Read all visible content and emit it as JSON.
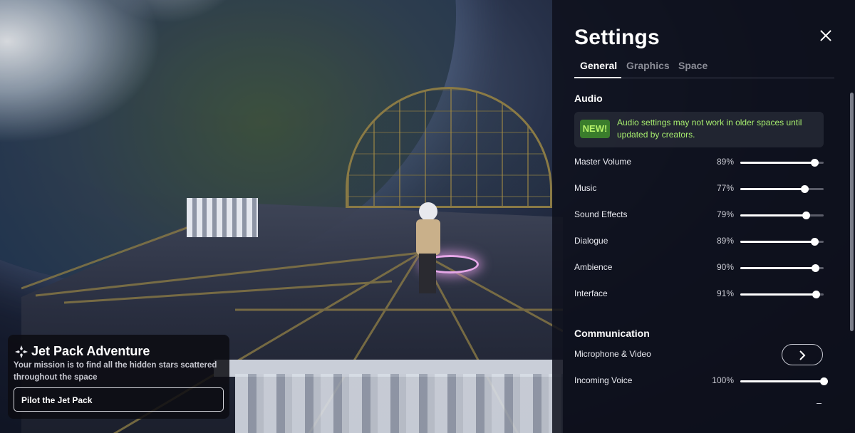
{
  "settings": {
    "title": "Settings",
    "tabs": [
      {
        "label": "General",
        "active": true
      },
      {
        "label": "Graphics",
        "active": false
      },
      {
        "label": "Space",
        "active": false
      }
    ],
    "audio": {
      "title": "Audio",
      "notice_badge": "NEW!",
      "notice_text": "Audio settings may not work in older spaces until updated by creators.",
      "sliders": [
        {
          "label": "Master Volume",
          "value": "89%",
          "level": 0.89
        },
        {
          "label": "Music",
          "value": "77%",
          "level": 0.77
        },
        {
          "label": "Sound Effects",
          "value": "79%",
          "level": 0.79
        },
        {
          "label": "Dialogue",
          "value": "89%",
          "level": 0.89
        },
        {
          "label": "Ambience",
          "value": "90%",
          "level": 0.9
        },
        {
          "label": "Interface",
          "value": "91%",
          "level": 0.91
        }
      ]
    },
    "communication": {
      "title": "Communication",
      "microphone_label": "Microphone & Video",
      "incoming_voice": {
        "label": "Incoming Voice",
        "value": "100%",
        "level": 1.0
      }
    }
  },
  "quest": {
    "title": "Jet Pack Adventure",
    "description": "Your mission is to find all the hidden stars scattered throughout the space",
    "button_label": "Pilot the Jet Pack"
  },
  "colors": {
    "notice_green": "#a6ec6e",
    "badge_bg": "#3a7d2c",
    "panel_bg": "#0e101c"
  },
  "icons": {
    "close": "close-icon",
    "chevron": "chevron-right-icon",
    "quest": "compass-icon"
  }
}
